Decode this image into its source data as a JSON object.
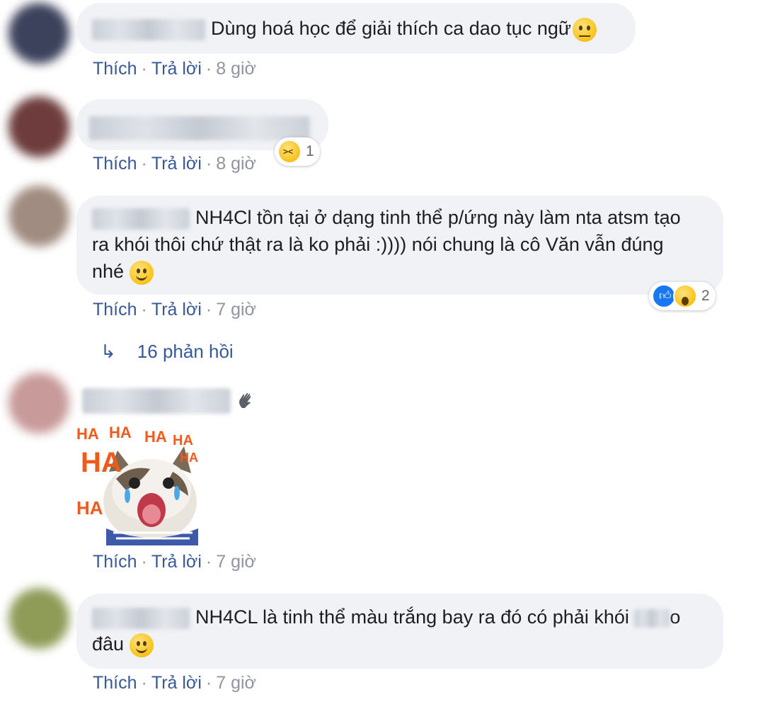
{
  "comments": [
    {
      "text": "Dùng hoá học để giải thích ca dao tục ngữ",
      "actions": {
        "like": "Thích",
        "reply": "Trả lời",
        "time": "8 giờ"
      },
      "avatar_color": "#3b3f5a"
    },
    {
      "text": "",
      "actions": {
        "like": "Thích",
        "reply": "Trả lời",
        "time": "8 giờ"
      },
      "reaction_count": "1",
      "avatar_color": "#6a3a3a"
    },
    {
      "text_line1": "NH4Cl tồn tại ở dạng tinh thể p/ứng này làm nta atsm tạo",
      "text_line2": "ra khói thôi chứ thật ra là ko phải :)))) nói chung là cô Văn vẫn đúng",
      "text_line3": "nhé",
      "actions": {
        "like": "Thích",
        "reply": "Trả lời",
        "time": "7 giờ"
      },
      "reaction_count": "2",
      "replies": "16 phản hồi",
      "avatar_color": "#9a8a7e"
    },
    {
      "sticker_text": [
        "HA",
        "HA",
        "HA",
        "HA",
        "HA",
        "HA",
        "HA"
      ],
      "actions": {
        "like": "Thích",
        "reply": "Trả lời",
        "time": "7 giờ"
      },
      "avatar_color": "#c9a0a0"
    },
    {
      "text_line1": "NH4CL là tinh thể màu trắng bay ra đó có phải khói",
      "text_line1_tail": "o",
      "text_line2": "đâu",
      "actions": {
        "like": "Thích",
        "reply": "Trả lời",
        "time": "7 giờ"
      },
      "avatar_color": "#8a9a5a"
    }
  ],
  "colors": {
    "link": "#385898",
    "muted": "#90949c",
    "bubble": "#f0f2f5",
    "like_blue": "#1877f2",
    "sticker_orange": "#f25a1c"
  },
  "icons": {
    "reply_arrow": "↳",
    "wave": "wave-hand-icon"
  }
}
